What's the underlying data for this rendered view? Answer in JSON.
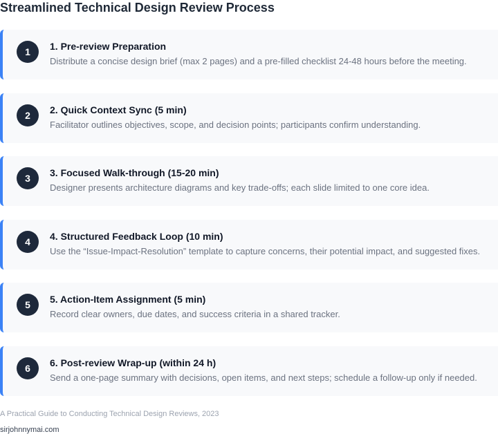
{
  "title": "Streamlined Technical Design Review Process",
  "colors": {
    "accent": "#3b82f6",
    "badge_bg": "#1e293b",
    "card_bg": "#f8f9fb"
  },
  "steps": [
    {
      "number": "1",
      "title": "1. Pre-review Preparation",
      "description": "Distribute a concise design brief (max 2 pages) and a pre-filled checklist 24-48 hours before the meeting."
    },
    {
      "number": "2",
      "title": "2. Quick Context Sync (5 min)",
      "description": "Facilitator outlines objectives, scope, and decision points; participants confirm understanding."
    },
    {
      "number": "3",
      "title": "3. Focused Walk-through (15-20 min)",
      "description": "Designer presents architecture diagrams and key trade-offs; each slide limited to one core idea."
    },
    {
      "number": "4",
      "title": "4. Structured Feedback Loop (10 min)",
      "description": "Use the “Issue-Impact-Resolution” template to capture concerns, their potential impact, and suggested fixes."
    },
    {
      "number": "5",
      "title": "5. Action-Item Assignment (5 min)",
      "description": "Record clear owners, due dates, and success criteria in a shared tracker."
    },
    {
      "number": "6",
      "title": "6. Post-review Wrap-up (within 24 h)",
      "description": "Send a one-page summary with decisions, open items, and next steps; schedule a follow-up only if needed."
    }
  ],
  "footer": {
    "source": "A Practical Guide to Conducting Technical Design Reviews, 2023",
    "site": "sirjohnnymai.com"
  }
}
